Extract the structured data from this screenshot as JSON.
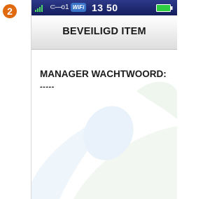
{
  "step": {
    "number": "2",
    "color": "#e06a10"
  },
  "status_bar": {
    "signal": "signal-bars-icon",
    "key_glyph": "⊂—ο",
    "key_count": "1",
    "wifi_label": "WiFi",
    "time": "13 50",
    "battery": "battery-icon",
    "background": "#1a2366"
  },
  "screen": {
    "title": "BEVEILIGD ITEM",
    "field": {
      "label": "MANAGER WACHTWOORD:",
      "value": "-----"
    }
  },
  "colors": {
    "accent_badge": "#e06a10",
    "battery_green": "#2ecc40",
    "wifi_blue": "#3a74c8",
    "bg_swirl": "#eaf3fb"
  }
}
